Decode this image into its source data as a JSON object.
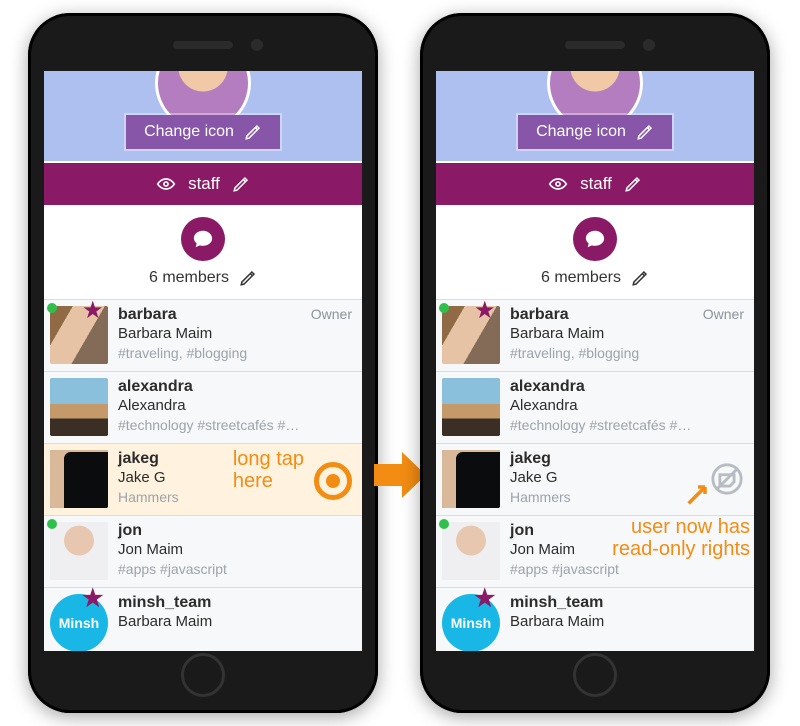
{
  "colors": {
    "brand": "#8a1966",
    "accent": "#f28c13",
    "hero": "#aec0ef",
    "changeBtn": "#8756a8"
  },
  "hero": {
    "change_icon_label": "Change icon"
  },
  "header": {
    "group_name": "staff"
  },
  "summary": {
    "members_label": "6 members"
  },
  "annotations": {
    "long_tap_l1": "long tap",
    "long_tap_l2": "here",
    "readonly_l1": "user now has",
    "readonly_l2": "read-only rights"
  },
  "members": [
    {
      "username": "barbara",
      "fullname": "Barbara Maim",
      "tags": "#traveling, #blogging",
      "role": "Owner",
      "online": true,
      "starred": true
    },
    {
      "username": "alexandra",
      "fullname": "Alexandra",
      "tags": "#technology #streetcafés #…",
      "role": "",
      "online": false,
      "starred": false
    },
    {
      "username": "jakeg",
      "fullname": "Jake G",
      "tags": "Hammers",
      "role": "",
      "online": false,
      "starred": false
    },
    {
      "username": "jon",
      "fullname": "Jon Maim",
      "tags": "#apps #javascript",
      "role": "",
      "online": true,
      "starred": false
    },
    {
      "username": "minsh_team",
      "fullname": "Barbara Maim",
      "tags": "",
      "role": "",
      "online": false,
      "starred": true
    }
  ]
}
